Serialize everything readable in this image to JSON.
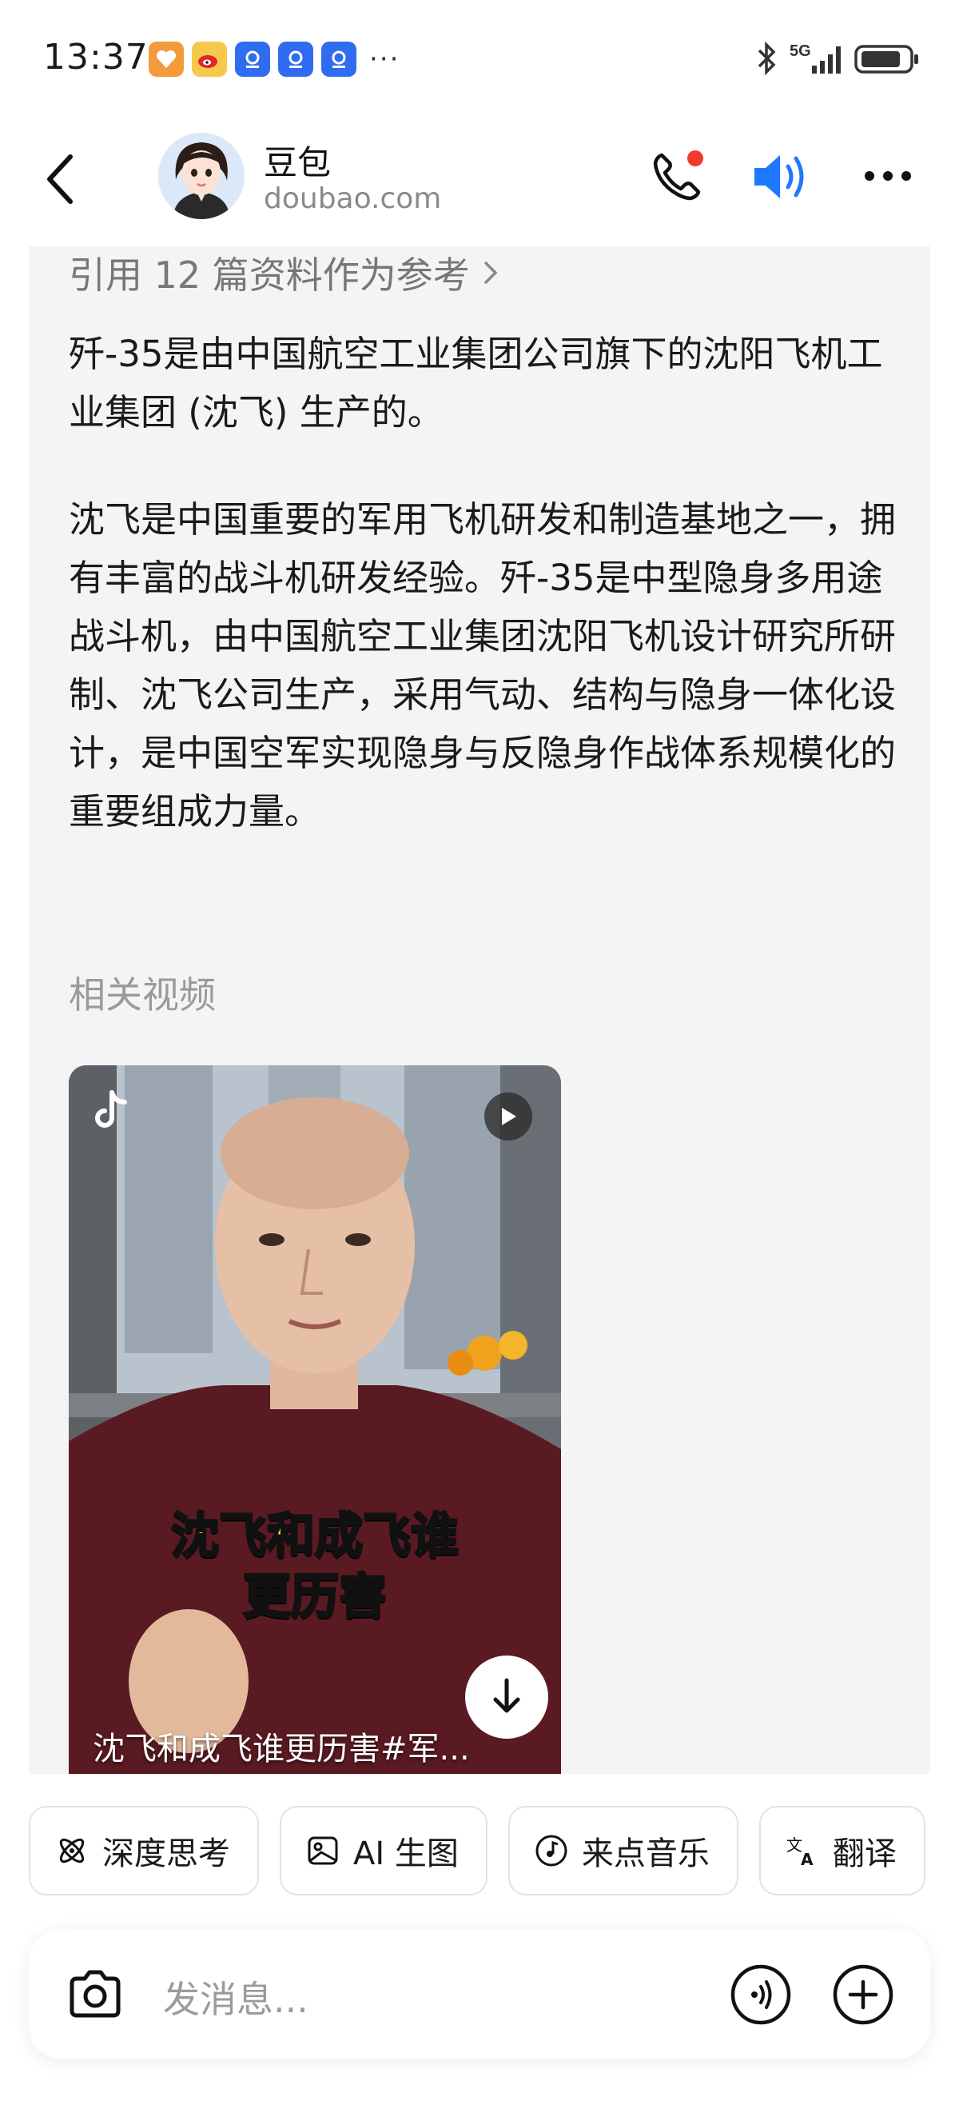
{
  "status_bar": {
    "time": "13:37",
    "network": "5G",
    "app_icons": [
      "heart-shield-app-icon",
      "weibo-icon",
      "blue-app-icon",
      "blue-app-icon",
      "blue-app-icon"
    ],
    "more": "···"
  },
  "header": {
    "title": "豆包",
    "subtitle": "doubao.com"
  },
  "message": {
    "references": "引用 12 篇资料作为参考",
    "paragraph1": "歼-35是由中国航空工业集团公司旗下的沈阳飞机工业集团 (沈飞) 生产的。",
    "paragraph2": "沈飞是中国重要的军用飞机研发和制造基地之一，拥有丰富的战斗机研发经验。歼-35是中型隐身多用途战斗机，由中国航空工业集团沈阳飞机设计研究所研制、沈飞公司生产，采用气动、结构与隐身一体化设计，是中国空军实现隐身与反隐身作战体系规模化的重要组成力量。",
    "related_videos_heading": "相关视频",
    "video": {
      "overlay_line1": "沈飞和成飞谁",
      "overlay_line2": "更历害",
      "title": "沈飞和成飞谁更历害#军..."
    }
  },
  "chips": [
    {
      "label": "深度思考",
      "icon": "atom-icon"
    },
    {
      "label": "AI 生图",
      "icon": "image-icon"
    },
    {
      "label": "来点音乐",
      "icon": "music-icon"
    },
    {
      "label": "翻译",
      "icon": "translate-icon"
    }
  ],
  "input": {
    "placeholder": "发消息..."
  },
  "colors": {
    "accent_blue": "#1e78ff",
    "notification_red": "#f03a2e",
    "card_bg": "#f4f4f4"
  }
}
